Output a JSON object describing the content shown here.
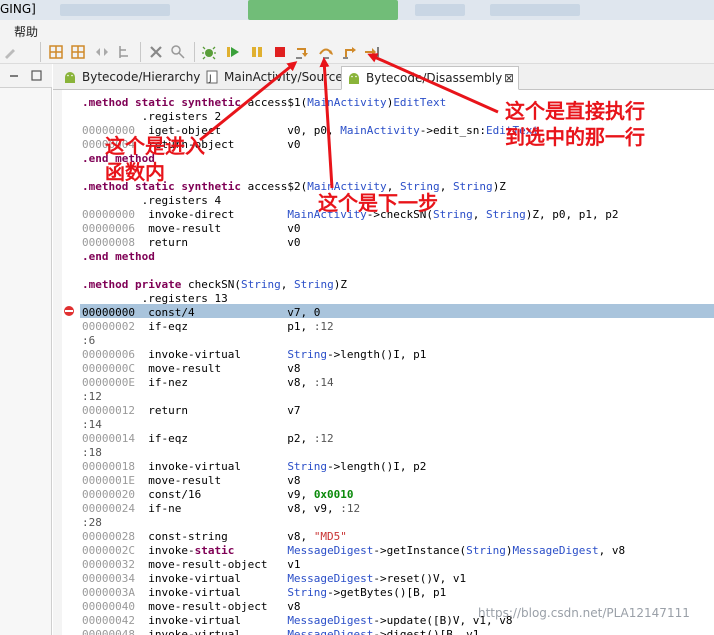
{
  "window": {
    "title_fragment": "GING]"
  },
  "menu": {
    "help": "帮助"
  },
  "tabs": [
    {
      "label": "Bytecode/Hierarchy"
    },
    {
      "label": "MainActivity/Source"
    },
    {
      "label": "Bytecode/Disassembly",
      "close": "⊠"
    }
  ],
  "toolbar": {
    "icons": [
      "pencil-icon",
      "separator",
      "grid-icon",
      "grid2-icon",
      "move-icon",
      "tree-icon",
      "delete-icon",
      "refactor-icon",
      "debug-icon",
      "run-icon",
      "pause-icon",
      "stop-icon",
      "step-into-icon",
      "step-over-icon",
      "step-return-icon",
      "run-to-line-icon"
    ]
  },
  "colors": {
    "accent_red": "#e8141a",
    "keyword": "#7f0055",
    "type": "#2a4ec8",
    "number": "#0a8a0a",
    "string": "#c83232",
    "highlight": "#a9c4dc"
  },
  "code": [
    {
      "a": "",
      "t": ".method static synthetic access$1(MainActivity)EditText"
    },
    {
      "a": "",
      "t": "         .registers 2"
    },
    {
      "a": "00000000",
      "t": "iget-object          v0, p0, MainActivity->edit_sn:EditText"
    },
    {
      "a": "00000004",
      "t": "return-object        v0"
    },
    {
      "a": "",
      "t": ".end method"
    },
    {
      "a": "",
      "t": ""
    },
    {
      "a": "",
      "t": ".method static synthetic access$2(MainActivity, String, String)Z"
    },
    {
      "a": "",
      "t": "         .registers 4"
    },
    {
      "a": "00000000",
      "t": "invoke-direct        MainActivity->checkSN(String, String)Z, p0, p1, p2"
    },
    {
      "a": "00000006",
      "t": "move-result          v0"
    },
    {
      "a": "00000008",
      "t": "return               v0"
    },
    {
      "a": "",
      "t": ".end method"
    },
    {
      "a": "",
      "t": ""
    },
    {
      "a": "",
      "t": ".method private checkSN(String, String)Z"
    },
    {
      "a": "",
      "t": "         .registers 13"
    },
    {
      "a": "00000000",
      "t": "const/4              v7, 0"
    },
    {
      "a": "00000002",
      "t": "if-eqz               p1, :12"
    },
    {
      "a": "",
      "t": ":6"
    },
    {
      "a": "00000006",
      "t": "invoke-virtual       String->length()I, p1"
    },
    {
      "a": "0000000C",
      "t": "move-result          v8"
    },
    {
      "a": "0000000E",
      "t": "if-nez               v8, :14"
    },
    {
      "a": "",
      "t": ":12"
    },
    {
      "a": "00000012",
      "t": "return               v7"
    },
    {
      "a": "",
      "t": ":14"
    },
    {
      "a": "00000014",
      "t": "if-eqz               p2, :12"
    },
    {
      "a": "",
      "t": ":18"
    },
    {
      "a": "00000018",
      "t": "invoke-virtual       String->length()I, p2"
    },
    {
      "a": "0000001E",
      "t": "move-result          v8"
    },
    {
      "a": "00000020",
      "t": "const/16             v9, 0x0010"
    },
    {
      "a": "00000024",
      "t": "if-ne                v8, v9, :12"
    },
    {
      "a": "",
      "t": ":28"
    },
    {
      "a": "00000028",
      "t": "const-string         v8, \"MD5\""
    },
    {
      "a": "0000002C",
      "t": "invoke-static        MessageDigest->getInstance(String)MessageDigest, v8"
    },
    {
      "a": "00000032",
      "t": "move-result-object   v1"
    },
    {
      "a": "00000034",
      "t": "invoke-virtual       MessageDigest->reset()V, v1"
    },
    {
      "a": "0000003A",
      "t": "invoke-virtual       String->getBytes()[B, p1"
    },
    {
      "a": "00000040",
      "t": "move-result-object   v8"
    },
    {
      "a": "00000042",
      "t": "invoke-virtual       MessageDigest->update([B)V, v1, v8"
    },
    {
      "a": "00000048",
      "t": "invoke-virtual       MessageDigest->digest()[B, v1"
    }
  ],
  "annotations": {
    "step_into": [
      "这个是进入",
      "函数内"
    ],
    "step_over": "这个是下一步",
    "run_to_line": [
      "这个是直接执行",
      "到选中的那一行"
    ]
  },
  "watermark": "https://blog.csdn.net/PLA12147111"
}
